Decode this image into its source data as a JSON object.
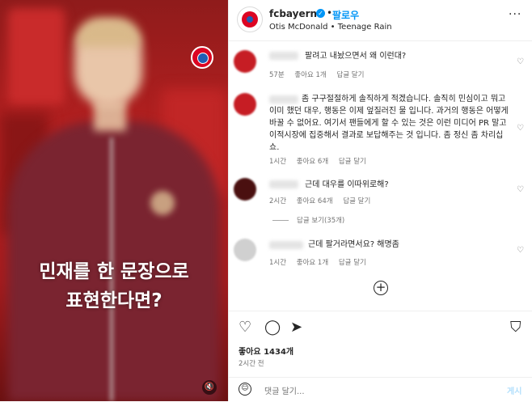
{
  "post": {
    "caption_line1": "민재를 한 문장으로",
    "caption_line2": "표현한다면?",
    "mute_icon": "🔇"
  },
  "header": {
    "username": "fcbayern",
    "verified_glyph": "✓",
    "separator": "•",
    "follow_label": "팔로우",
    "music": "Otis McDonald • Teenage Rain",
    "more_glyph": "···"
  },
  "comments": [
    {
      "text": "팔려고 내놨으면서 왜 이런대?",
      "time": "57분",
      "likes": "좋아요 1개",
      "reply": "답글 달기"
    },
    {
      "text": "좀 구구절절하게 솔직하게 적겠습니다. 솔직히 민심이고 뭐고 이미 했던 대우, 행동은 이제 엎질러진 물 입니다. 과거의 행동은 어떻게 바꿀 수 없어요. 여기서 팬들에게 할 수 있는 것은 이런 미디어 PR 말고 이적시장에 집중해서 결과로 보답해주는 것 입니다. 좀 정신 좀 차리십쇼.",
      "time": "1시간",
      "likes": "좋아요 6개",
      "reply": "답글 달기"
    },
    {
      "text": "근데 대우를 이따위로해?",
      "time": "2시간",
      "likes": "좋아요 64개",
      "reply": "답글 달기"
    },
    {
      "text": "근데 팔거라면서요? 해명좀",
      "time": "1시간",
      "likes": "좋아요 1개",
      "reply": "답글 달기"
    }
  ],
  "view_replies": "답글 보기(35개)",
  "plus_glyph": "+",
  "actions": {
    "like": "♡",
    "comment": "◯",
    "share": "➤",
    "save": "⛉"
  },
  "likes_count": "좋아요 1434개",
  "posted_time": "2시간 전",
  "comment_box": {
    "emoji": "☺",
    "placeholder": "댓글 달기...",
    "post_label": "게시"
  },
  "heart_glyph": "♡",
  "colors": {
    "brand_red": "#dc0522",
    "follow_blue": "#0095f6"
  }
}
